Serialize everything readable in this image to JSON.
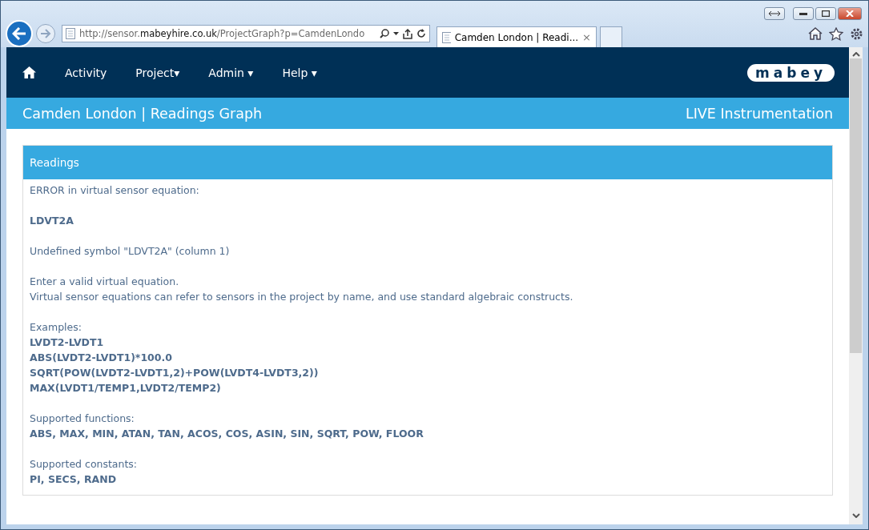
{
  "browser": {
    "address": {
      "scheme": "http://sensor.",
      "domain": "mabeyhire.co.uk",
      "path": "/ProjectGraph?p=CamdenLondo"
    },
    "tabs": [
      {
        "title": "Camden London | Readi...",
        "close": "×",
        "selected": true
      }
    ]
  },
  "nav": {
    "items": [
      {
        "label": "Activity"
      },
      {
        "label": "Project▾"
      },
      {
        "label": "Admin ▾"
      },
      {
        "label": "Help ▾"
      }
    ],
    "logo": "mabey"
  },
  "subheader": {
    "title": "Camden London | Readings Graph",
    "right": "LIVE Instrumentation"
  },
  "panel": {
    "title": "Readings",
    "paragraphs": [
      [
        {
          "text": "ERROR in virtual sensor equation:",
          "bold": false
        }
      ],
      [
        {
          "text": "LDVT2A",
          "bold": true
        }
      ],
      [
        {
          "text": "Undefined symbol \"LDVT2A\" (column 1)",
          "bold": false
        }
      ],
      [
        {
          "text": "Enter a valid virtual equation.",
          "bold": false
        },
        {
          "text": "Virtual sensor equations can refer to sensors in the project by name, and use standard algebraic constructs.",
          "bold": false
        }
      ],
      [
        {
          "text": "Examples:",
          "bold": false
        },
        {
          "text": "LVDT2-LVDT1",
          "bold": true
        },
        {
          "text": "ABS(LVDT2-LVDT1)*100.0",
          "bold": true
        },
        {
          "text": "SQRT(POW(LVDT2-LVDT1,2)+POW(LVDT4-LVDT3,2))",
          "bold": true
        },
        {
          "text": "MAX(LVDT1/TEMP1,LVDT2/TEMP2)",
          "bold": true
        }
      ],
      [
        {
          "text": "Supported functions:",
          "bold": false
        },
        {
          "text": "ABS, MAX, MIN, ATAN, TAN, ACOS, COS, ASIN, SIN, SQRT, POW, FLOOR",
          "bold": true
        }
      ],
      [
        {
          "text": "Supported constants:",
          "bold": false
        },
        {
          "text": "PI, SECS, RAND",
          "bold": true
        }
      ]
    ]
  }
}
